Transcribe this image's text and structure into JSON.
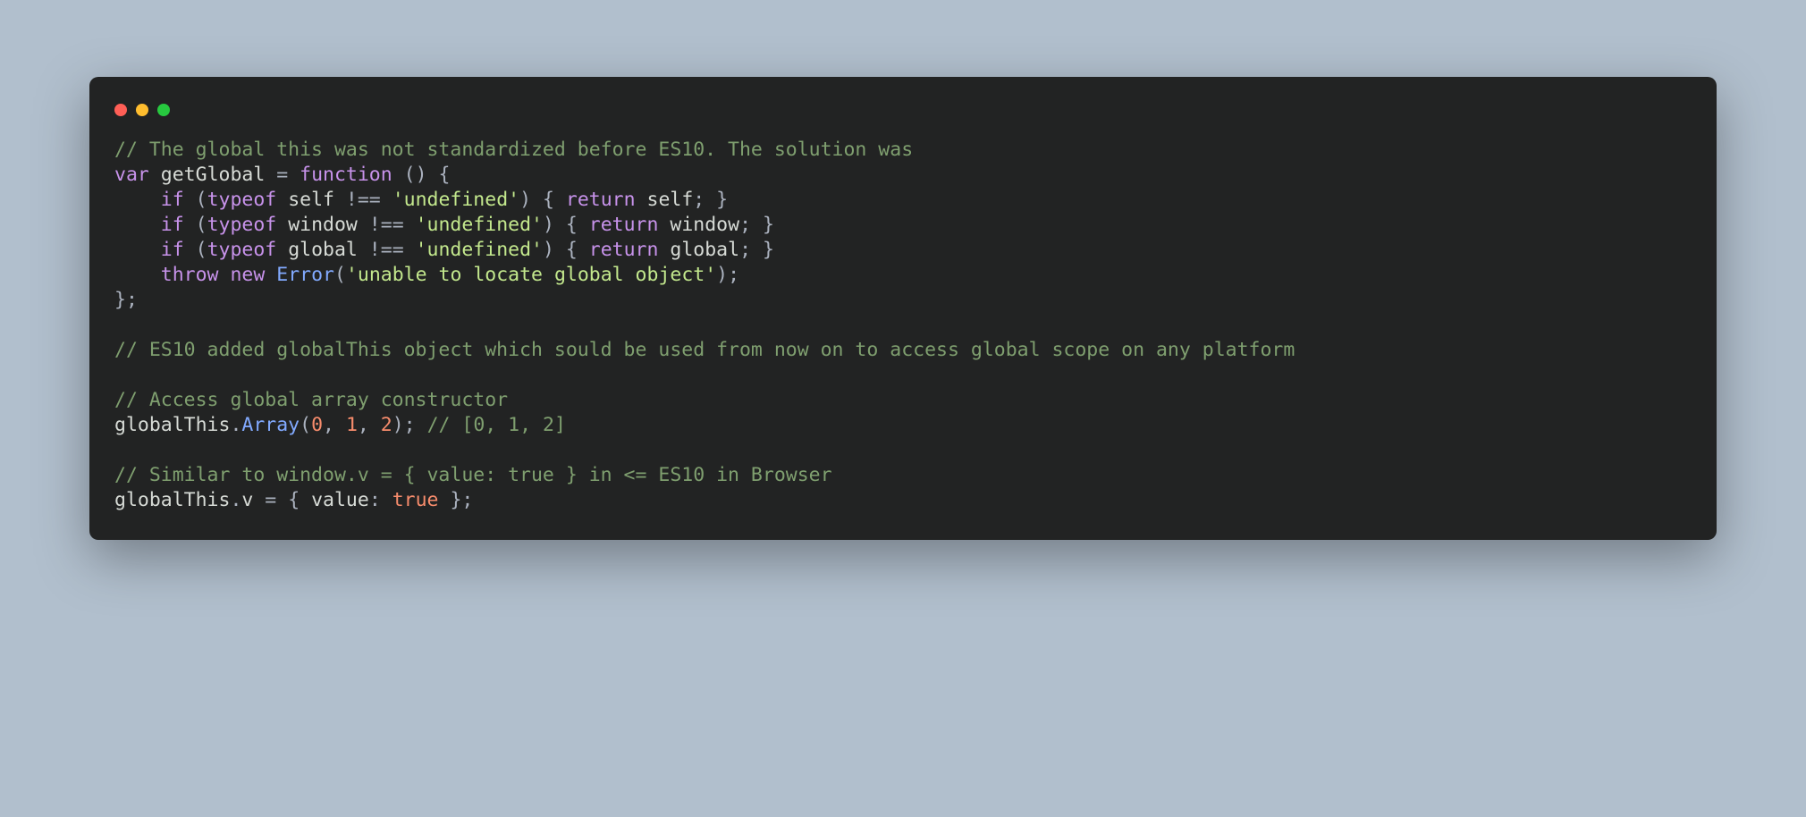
{
  "traffic_lights": [
    "red",
    "yellow",
    "green"
  ],
  "colors": {
    "page_bg": "#b1bfcd",
    "editor_bg": "#222323",
    "comment": "#7f9f6f",
    "keyword": "#c792ea",
    "identifier": "#d7dbd6",
    "function": "#82aaff",
    "string": "#c3e88d",
    "punct": "#abb2bf",
    "bool": "#f78c6c"
  },
  "code": {
    "plain_lines": [
      "// The global this was not standardized before ES10. The solution was",
      "var getGlobal = function () {",
      "    if (typeof self !== 'undefined') { return self; }",
      "    if (typeof window !== 'undefined') { return window; }",
      "    if (typeof global !== 'undefined') { return global; }",
      "    throw new Error('unable to locate global object');",
      "};",
      "",
      "// ES10 added globalThis object which sould be used from now on to access global scope on any platform",
      "",
      "// Access global array constructor",
      "globalThis.Array(0, 1, 2); // [0, 1, 2]",
      "",
      "// Similar to window.v = { value: true } in <= ES10 in Browser",
      "globalThis.v = { value: true };"
    ],
    "tokenized_lines": [
      [
        [
          "cm",
          "// The global this was not standardized before ES10. The solution was"
        ]
      ],
      [
        [
          "kw",
          "var"
        ],
        [
          "pn",
          " "
        ],
        [
          "id",
          "getGlobal"
        ],
        [
          "pn",
          " = "
        ],
        [
          "kw",
          "function"
        ],
        [
          "pn",
          " () {"
        ]
      ],
      [
        [
          "pn",
          "    "
        ],
        [
          "kw",
          "if"
        ],
        [
          "pn",
          " ("
        ],
        [
          "kw",
          "typeof"
        ],
        [
          "pn",
          " "
        ],
        [
          "id",
          "self"
        ],
        [
          "pn",
          " !== "
        ],
        [
          "st",
          "'undefined'"
        ],
        [
          "pn",
          ") { "
        ],
        [
          "kw",
          "return"
        ],
        [
          "pn",
          " "
        ],
        [
          "id",
          "self"
        ],
        [
          "pn",
          "; }"
        ]
      ],
      [
        [
          "pn",
          "    "
        ],
        [
          "kw",
          "if"
        ],
        [
          "pn",
          " ("
        ],
        [
          "kw",
          "typeof"
        ],
        [
          "pn",
          " "
        ],
        [
          "id",
          "window"
        ],
        [
          "pn",
          " !== "
        ],
        [
          "st",
          "'undefined'"
        ],
        [
          "pn",
          ") { "
        ],
        [
          "kw",
          "return"
        ],
        [
          "pn",
          " "
        ],
        [
          "id",
          "window"
        ],
        [
          "pn",
          "; }"
        ]
      ],
      [
        [
          "pn",
          "    "
        ],
        [
          "kw",
          "if"
        ],
        [
          "pn",
          " ("
        ],
        [
          "kw",
          "typeof"
        ],
        [
          "pn",
          " "
        ],
        [
          "id",
          "global"
        ],
        [
          "pn",
          " !== "
        ],
        [
          "st",
          "'undefined'"
        ],
        [
          "pn",
          ") { "
        ],
        [
          "kw",
          "return"
        ],
        [
          "pn",
          " "
        ],
        [
          "id",
          "global"
        ],
        [
          "pn",
          "; }"
        ]
      ],
      [
        [
          "pn",
          "    "
        ],
        [
          "kw",
          "throw"
        ],
        [
          "pn",
          " "
        ],
        [
          "kw",
          "new"
        ],
        [
          "pn",
          " "
        ],
        [
          "fn",
          "Error"
        ],
        [
          "pn",
          "("
        ],
        [
          "st",
          "'unable to locate global object'"
        ],
        [
          "pn",
          ");"
        ]
      ],
      [
        [
          "pn",
          "};"
        ]
      ],
      [
        [
          "pn",
          ""
        ]
      ],
      [
        [
          "cm",
          "// ES10 added globalThis object which sould be used from now on to access global scope on any platform"
        ]
      ],
      [
        [
          "pn",
          ""
        ]
      ],
      [
        [
          "cm",
          "// Access global array constructor"
        ]
      ],
      [
        [
          "id",
          "globalThis"
        ],
        [
          "pn",
          "."
        ],
        [
          "fn",
          "Array"
        ],
        [
          "pn",
          "("
        ],
        [
          "bo",
          "0"
        ],
        [
          "pn",
          ", "
        ],
        [
          "bo",
          "1"
        ],
        [
          "pn",
          ", "
        ],
        [
          "bo",
          "2"
        ],
        [
          "pn",
          "); "
        ],
        [
          "cm",
          "// [0, 1, 2]"
        ]
      ],
      [
        [
          "pn",
          ""
        ]
      ],
      [
        [
          "cm",
          "// Similar to window.v = { value: true } in <= ES10 in Browser"
        ]
      ],
      [
        [
          "id",
          "globalThis"
        ],
        [
          "pn",
          "."
        ],
        [
          "id",
          "v"
        ],
        [
          "pn",
          " = { "
        ],
        [
          "id",
          "value"
        ],
        [
          "pn",
          ": "
        ],
        [
          "bo",
          "true"
        ],
        [
          "pn",
          " };"
        ]
      ]
    ]
  }
}
